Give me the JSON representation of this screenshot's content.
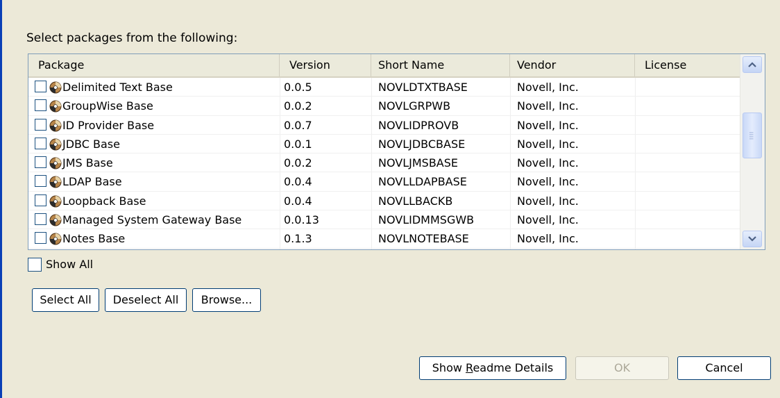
{
  "prompt": "Select packages from the following:",
  "table": {
    "columns": [
      "Package",
      "Version",
      "Short Name",
      "Vendor",
      "License"
    ],
    "rows": [
      {
        "package": "Delimited Text Base",
        "version": "0.0.5",
        "short_name": "NOVLDTXTBASE",
        "vendor": "Novell, Inc.",
        "license": ""
      },
      {
        "package": "GroupWise Base",
        "version": "0.0.2",
        "short_name": "NOVLGRPWB",
        "vendor": "Novell, Inc.",
        "license": ""
      },
      {
        "package": "ID Provider Base",
        "version": "0.0.7",
        "short_name": "NOVLIDPROVB",
        "vendor": "Novell, Inc.",
        "license": ""
      },
      {
        "package": "JDBC Base",
        "version": "0.0.1",
        "short_name": "NOVLJDBCBASE",
        "vendor": "Novell, Inc.",
        "license": ""
      },
      {
        "package": "JMS Base",
        "version": "0.0.2",
        "short_name": "NOVLJMSBASE",
        "vendor": "Novell, Inc.",
        "license": ""
      },
      {
        "package": "LDAP Base",
        "version": "0.0.4",
        "short_name": "NOVLLDAPBASE",
        "vendor": "Novell, Inc.",
        "license": ""
      },
      {
        "package": "Loopback Base",
        "version": "0.0.4",
        "short_name": "NOVLLBACKB",
        "vendor": "Novell, Inc.",
        "license": ""
      },
      {
        "package": "Managed System Gateway Base",
        "version": "0.0.13",
        "short_name": "NOVLIDMMSGWB",
        "vendor": "Novell, Inc.",
        "license": ""
      },
      {
        "package": "Notes Base",
        "version": "0.1.3",
        "short_name": "NOVLNOTEBASE",
        "vendor": "Novell, Inc.",
        "license": ""
      }
    ]
  },
  "show_all": {
    "label": "Show All",
    "checked": false
  },
  "buttons": {
    "select_all": "Select All",
    "deselect_all": "Deselect All",
    "browse": "Browse...",
    "readme_pre": "Show ",
    "readme_mnemonic": "R",
    "readme_post": "eadme Details",
    "ok": "OK",
    "cancel": "Cancel"
  },
  "icons": {
    "row_icon": "package-icon",
    "scroll_up": "scroll-up-arrow-icon",
    "scroll_down": "scroll-down-arrow-icon"
  },
  "colors": {
    "dialog_bg": "#ece9d8",
    "border_blue": "#7f9db9",
    "window_edge": "#0a3fb6"
  }
}
